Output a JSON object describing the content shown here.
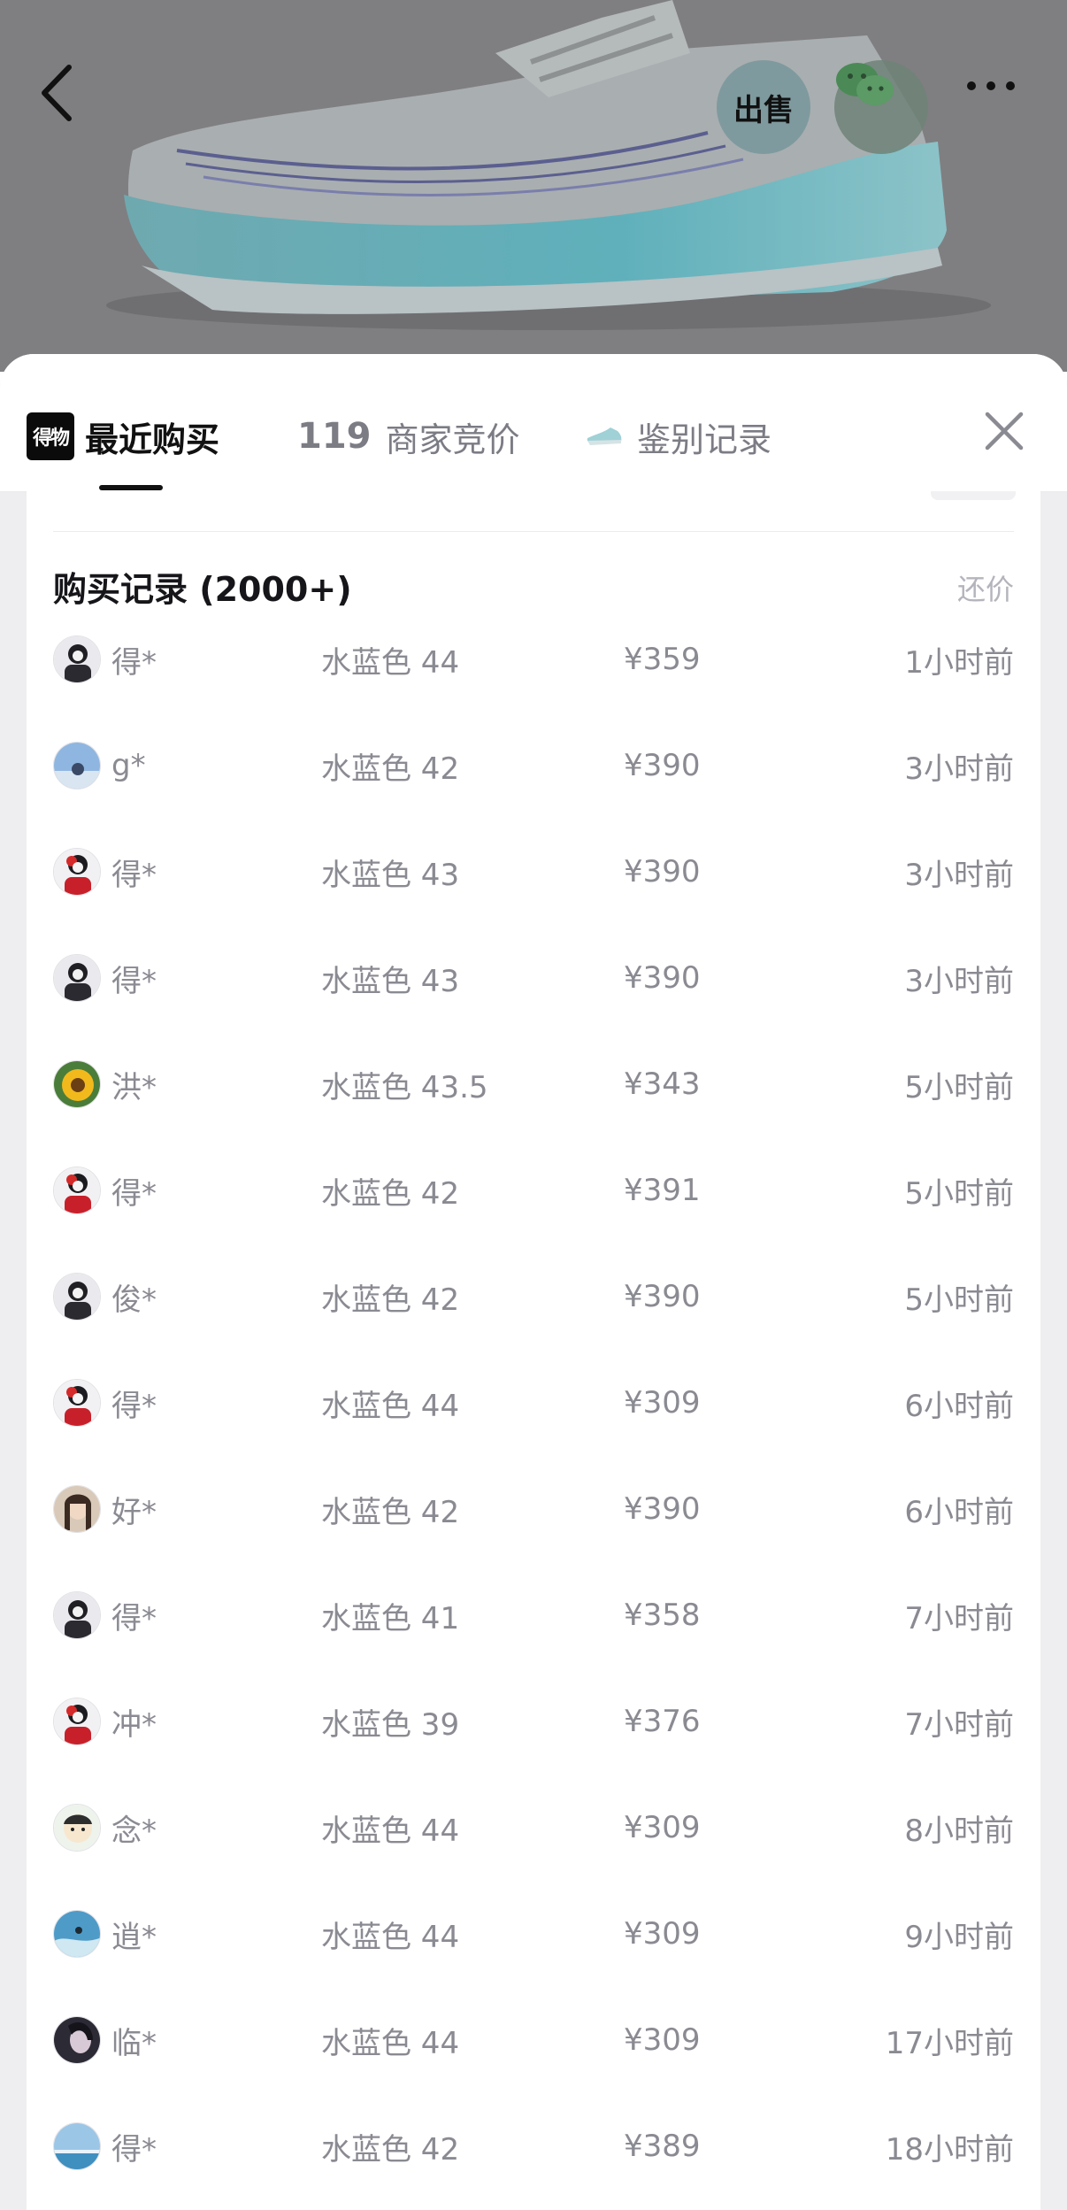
{
  "hero": {
    "sell_label": "出售",
    "icons": [
      "back-arrow-icon",
      "wechat-icon",
      "more-icon"
    ]
  },
  "tabs": {
    "recent": {
      "label": "最近购买",
      "logo": "得物"
    },
    "bids": {
      "count": "119",
      "label": "商家竞价"
    },
    "auth": {
      "label": "鉴别记录"
    }
  },
  "section": {
    "title": "购买记录 (2000+)",
    "action": "还价"
  },
  "records": [
    {
      "user": "得*",
      "spec": "水蓝色 44",
      "price": "¥359",
      "time": "1小时前",
      "avatar": "dark"
    },
    {
      "user": "g*",
      "spec": "水蓝色 42",
      "price": "¥390",
      "time": "3小时前",
      "avatar": "sky"
    },
    {
      "user": "得*",
      "spec": "水蓝色 43",
      "price": "¥390",
      "time": "3小时前",
      "avatar": "red"
    },
    {
      "user": "得*",
      "spec": "水蓝色 43",
      "price": "¥390",
      "time": "3小时前",
      "avatar": "dark"
    },
    {
      "user": "洪*",
      "spec": "水蓝色 43.5",
      "price": "¥343",
      "time": "5小时前",
      "avatar": "sunflower"
    },
    {
      "user": "得*",
      "spec": "水蓝色 42",
      "price": "¥391",
      "time": "5小时前",
      "avatar": "red"
    },
    {
      "user": "俊*",
      "spec": "水蓝色 42",
      "price": "¥390",
      "time": "5小时前",
      "avatar": "dark"
    },
    {
      "user": "得*",
      "spec": "水蓝色 44",
      "price": "¥309",
      "time": "6小时前",
      "avatar": "red"
    },
    {
      "user": "好*",
      "spec": "水蓝色 42",
      "price": "¥390",
      "time": "6小时前",
      "avatar": "portrait"
    },
    {
      "user": "得*",
      "spec": "水蓝色 41",
      "price": "¥358",
      "time": "7小时前",
      "avatar": "dark"
    },
    {
      "user": "冲*",
      "spec": "水蓝色 39",
      "price": "¥376",
      "time": "7小时前",
      "avatar": "red"
    },
    {
      "user": "念*",
      "spec": "水蓝色 44",
      "price": "¥309",
      "time": "8小时前",
      "avatar": "cartoon"
    },
    {
      "user": "逍*",
      "spec": "水蓝色 44",
      "price": "¥309",
      "time": "9小时前",
      "avatar": "surf"
    },
    {
      "user": "临*",
      "spec": "水蓝色 44",
      "price": "¥309",
      "time": "17小时前",
      "avatar": "night"
    },
    {
      "user": "得*",
      "spec": "水蓝色 42",
      "price": "¥389",
      "time": "18小时前",
      "avatar": "sea"
    }
  ]
}
